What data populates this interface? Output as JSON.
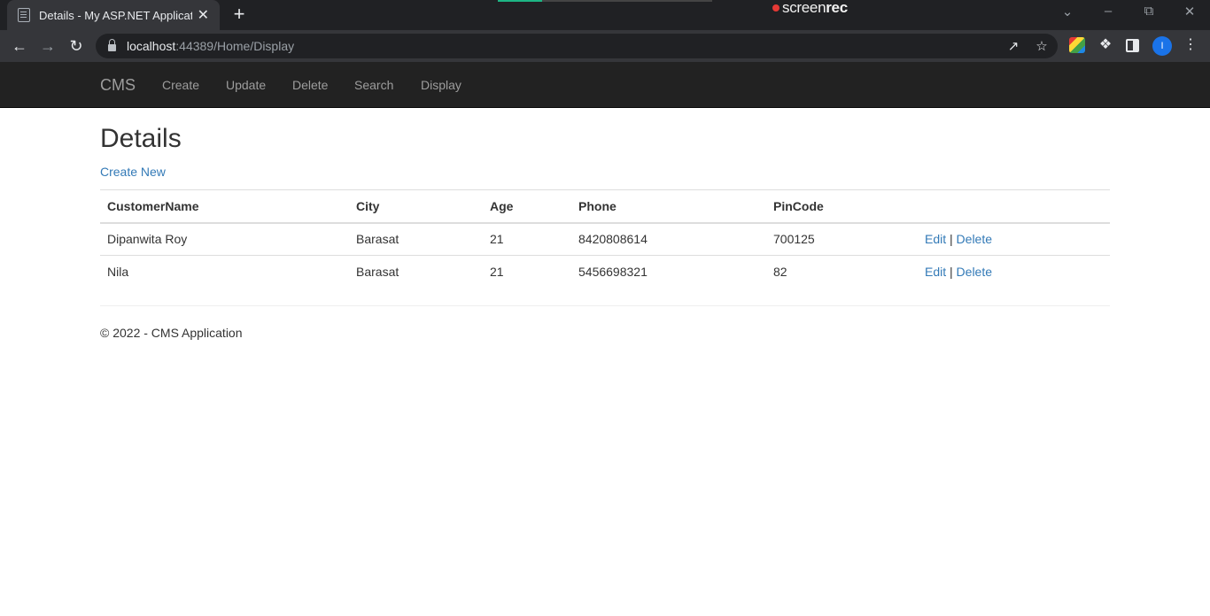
{
  "browser": {
    "tab_title": "Details - My ASP.NET Application",
    "url_host": "localhost",
    "url_rest": ":44389/Home/Display",
    "recorder": {
      "brand_a": "screen",
      "brand_b": "rec"
    },
    "icons": [
      "page-icon",
      "close-icon",
      "plus-icon",
      "back-icon",
      "forward-icon",
      "reload-icon",
      "lock-icon",
      "share-icon",
      "star-icon",
      "extension-icon",
      "puzzle-icon",
      "sidepanel-icon",
      "menu-icon",
      "minimize-icon",
      "restore-icon",
      "close-window-icon",
      "tab-search-icon"
    ],
    "profile_initial": "I"
  },
  "navbar": {
    "brand": "CMS",
    "links": [
      "Create",
      "Update",
      "Delete",
      "Search",
      "Display"
    ]
  },
  "main": {
    "title": "Details",
    "create_new": "Create New",
    "table": {
      "headers": [
        "CustomerName",
        "City",
        "Age",
        "Phone",
        "PinCode"
      ],
      "rows": [
        {
          "name": "Dipanwita Roy",
          "city": "Barasat",
          "age": "21",
          "phone": "8420808614",
          "pincode": "700125",
          "edit": "Edit",
          "sep": "|",
          "delete": "Delete"
        },
        {
          "name": "Nila",
          "city": "Barasat",
          "age": "21",
          "phone": "5456698321",
          "pincode": "82",
          "edit": "Edit",
          "sep": "|",
          "delete": "Delete"
        }
      ]
    }
  },
  "footer": {
    "text": "© 2022 - CMS Application"
  },
  "colors": {
    "navbar": "#222222",
    "link": "#337ab7",
    "chrome_dark": "#202124",
    "chrome_tab": "#35363a",
    "recorder_accent": "#1db584"
  }
}
